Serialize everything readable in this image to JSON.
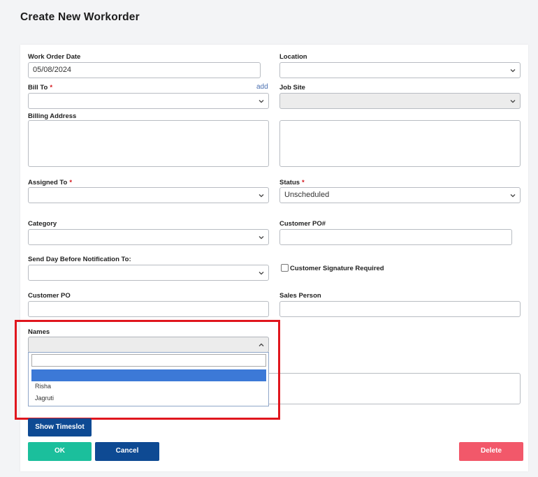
{
  "page": {
    "title": "Create New Workorder"
  },
  "form": {
    "work_order_date": {
      "label": "Work Order Date",
      "value": "05/08/2024"
    },
    "location": {
      "label": "Location",
      "value": ""
    },
    "bill_to": {
      "label": "Bill To",
      "required_mark": "*",
      "add_link": "add",
      "value": ""
    },
    "job_site": {
      "label": "Job Site",
      "value": ""
    },
    "billing_address": {
      "label": "Billing Address",
      "value": ""
    },
    "assigned_to": {
      "label": "Assigned To",
      "required_mark": "*",
      "value": ""
    },
    "status": {
      "label": "Status",
      "required_mark": "*",
      "value": "Unscheduled"
    },
    "category": {
      "label": "Category",
      "value": ""
    },
    "customer_po_number": {
      "label": "Customer PO#",
      "value": ""
    },
    "send_day_before": {
      "label": "Send Day Before Notification To:",
      "value": ""
    },
    "customer_signature": {
      "label": "Customer Signature Required",
      "checked": false
    },
    "customer_po": {
      "label": "Customer PO",
      "value": ""
    },
    "sales_person": {
      "label": "Sales Person",
      "value": ""
    },
    "names": {
      "label": "Names",
      "value": "",
      "open": true,
      "search_value": "",
      "options": [
        "",
        "Risha",
        "Jagruti"
      ],
      "highlighted_index": 0
    }
  },
  "buttons": {
    "show_timeslot": "Show Timeslot",
    "ok": "OK",
    "cancel": "Cancel",
    "delete": "Delete"
  },
  "colors": {
    "ok": "#1bbf9c",
    "cancel": "#0e4a93",
    "show_timeslot": "#0e4a93",
    "delete": "#f2586a",
    "highlight_border": "#e0161e",
    "dropdown_selected": "#3c79d7",
    "required": "#d4141a"
  },
  "icons": {
    "select_arrow": "chevron-down-icon",
    "open_select_arrow": "chevron-up-icon",
    "dropdown_search": "search-icon"
  }
}
